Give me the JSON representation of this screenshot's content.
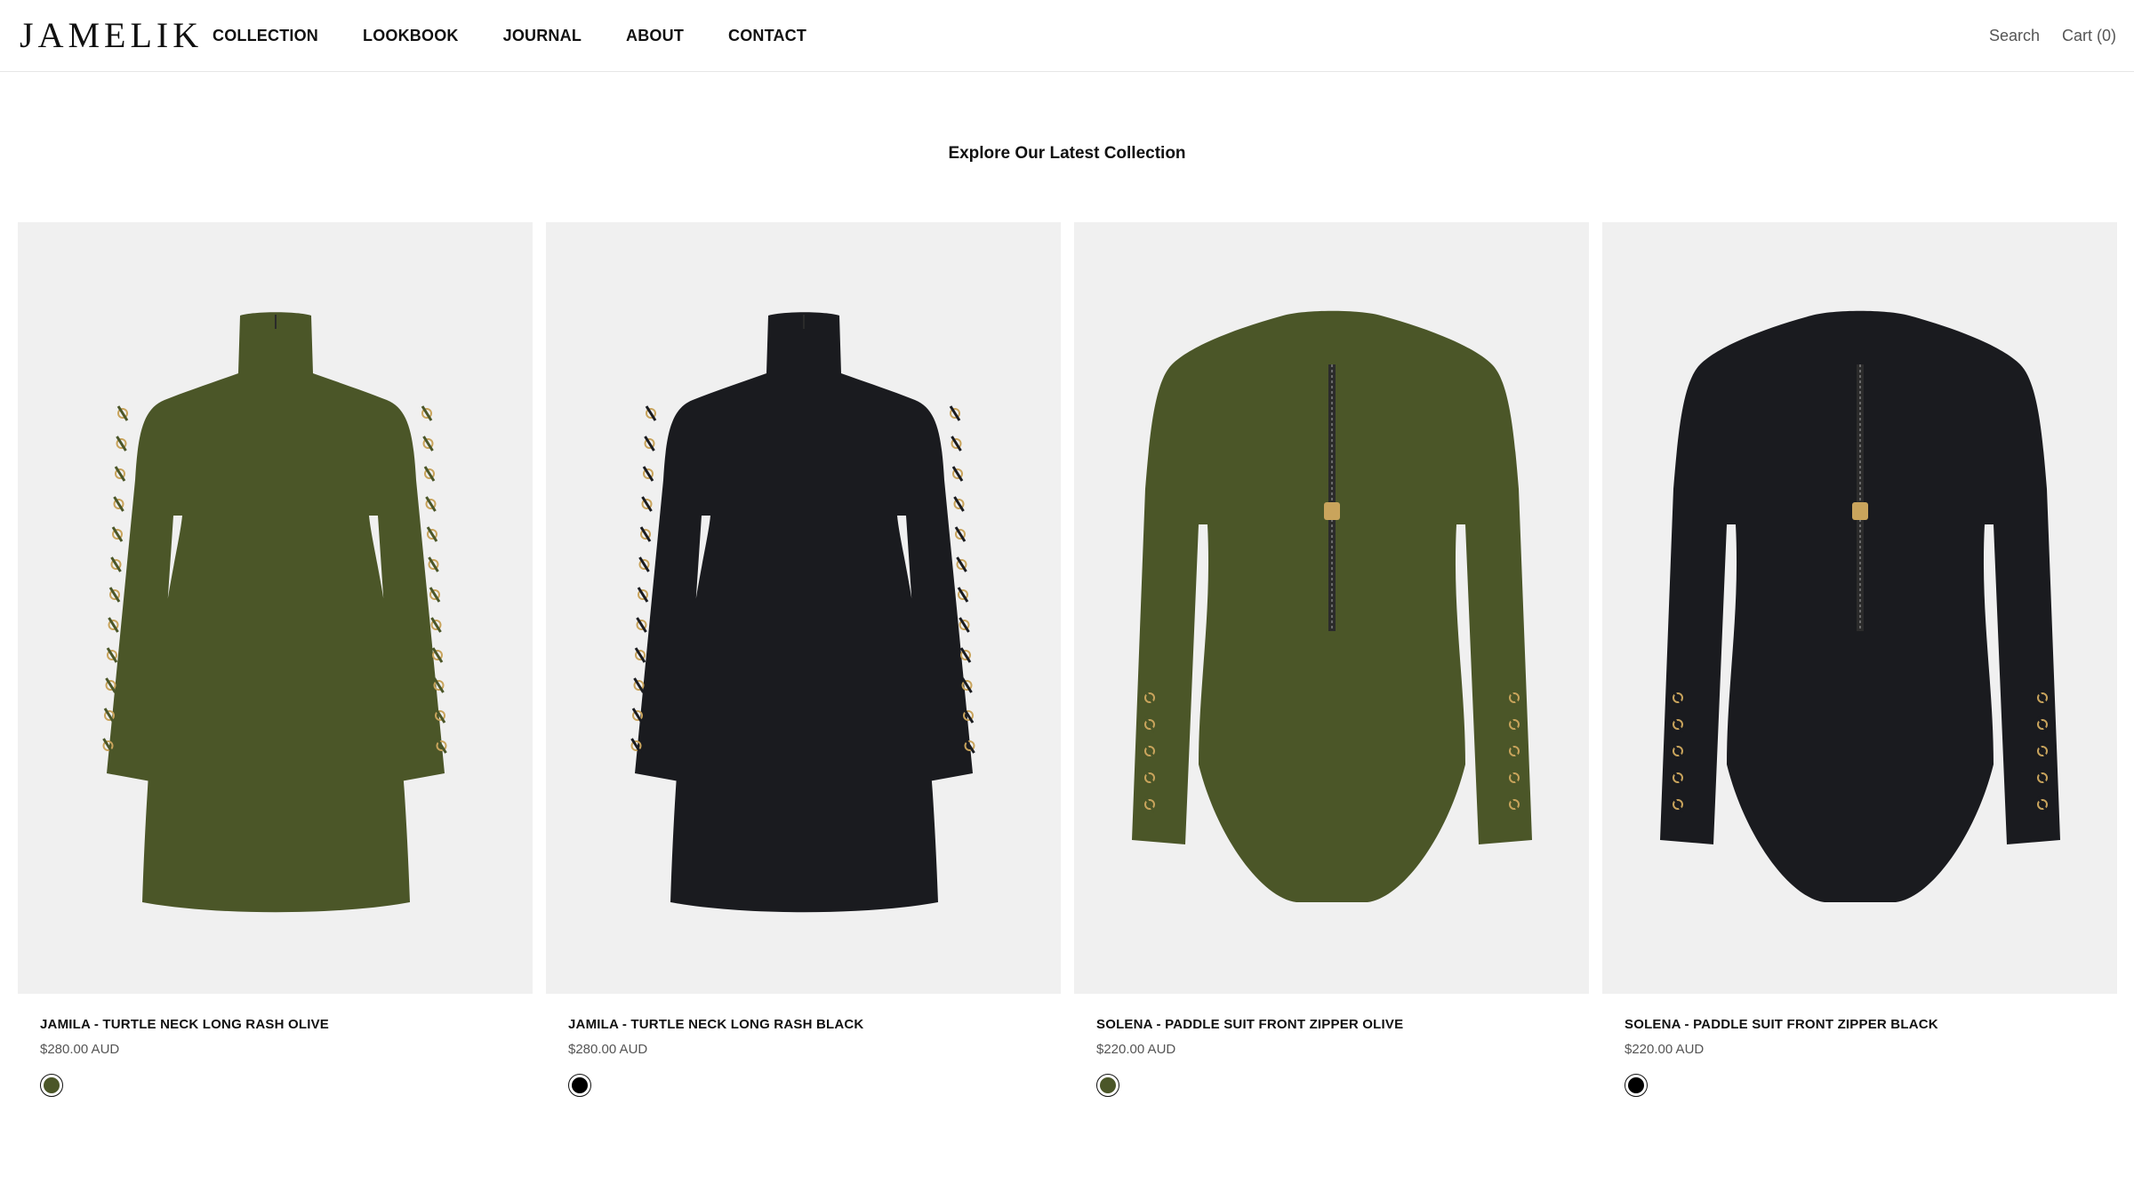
{
  "brand": {
    "logo_text": "JAMELIK"
  },
  "nav": {
    "items": [
      {
        "label": "COLLECTION"
      },
      {
        "label": "LOOKBOOK"
      },
      {
        "label": "JOURNAL"
      },
      {
        "label": "ABOUT"
      },
      {
        "label": "CONTACT"
      }
    ]
  },
  "utils": {
    "search_label": "Search",
    "cart_label": "Cart (0)"
  },
  "section": {
    "title": "Explore Our Latest Collection"
  },
  "products": [
    {
      "title": "JAMILA - TURTLE NECK LONG RASH OLIVE",
      "price": "$280.00 AUD",
      "swatch_color": "#4b5628",
      "garment": "dress",
      "garment_color": "#4b5628"
    },
    {
      "title": "JAMILA - TURTLE NECK LONG RASH BLACK",
      "price": "$280.00 AUD",
      "swatch_color": "#000000",
      "garment": "dress",
      "garment_color": "#1a1b1f"
    },
    {
      "title": "SOLENA - PADDLE SUIT FRONT ZIPPER OLIVE",
      "price": "$220.00 AUD",
      "swatch_color": "#4b5628",
      "garment": "suit",
      "garment_color": "#4b5628"
    },
    {
      "title": "SOLENA - PADDLE SUIT FRONT ZIPPER BLACK",
      "price": "$220.00 AUD",
      "swatch_color": "#000000",
      "garment": "suit",
      "garment_color": "#1a1b1f"
    }
  ],
  "colors": {
    "image_bg": "#f0f0f0",
    "text": "#111111",
    "muted": "#555555",
    "hardware_gold": "#c9a45c"
  }
}
